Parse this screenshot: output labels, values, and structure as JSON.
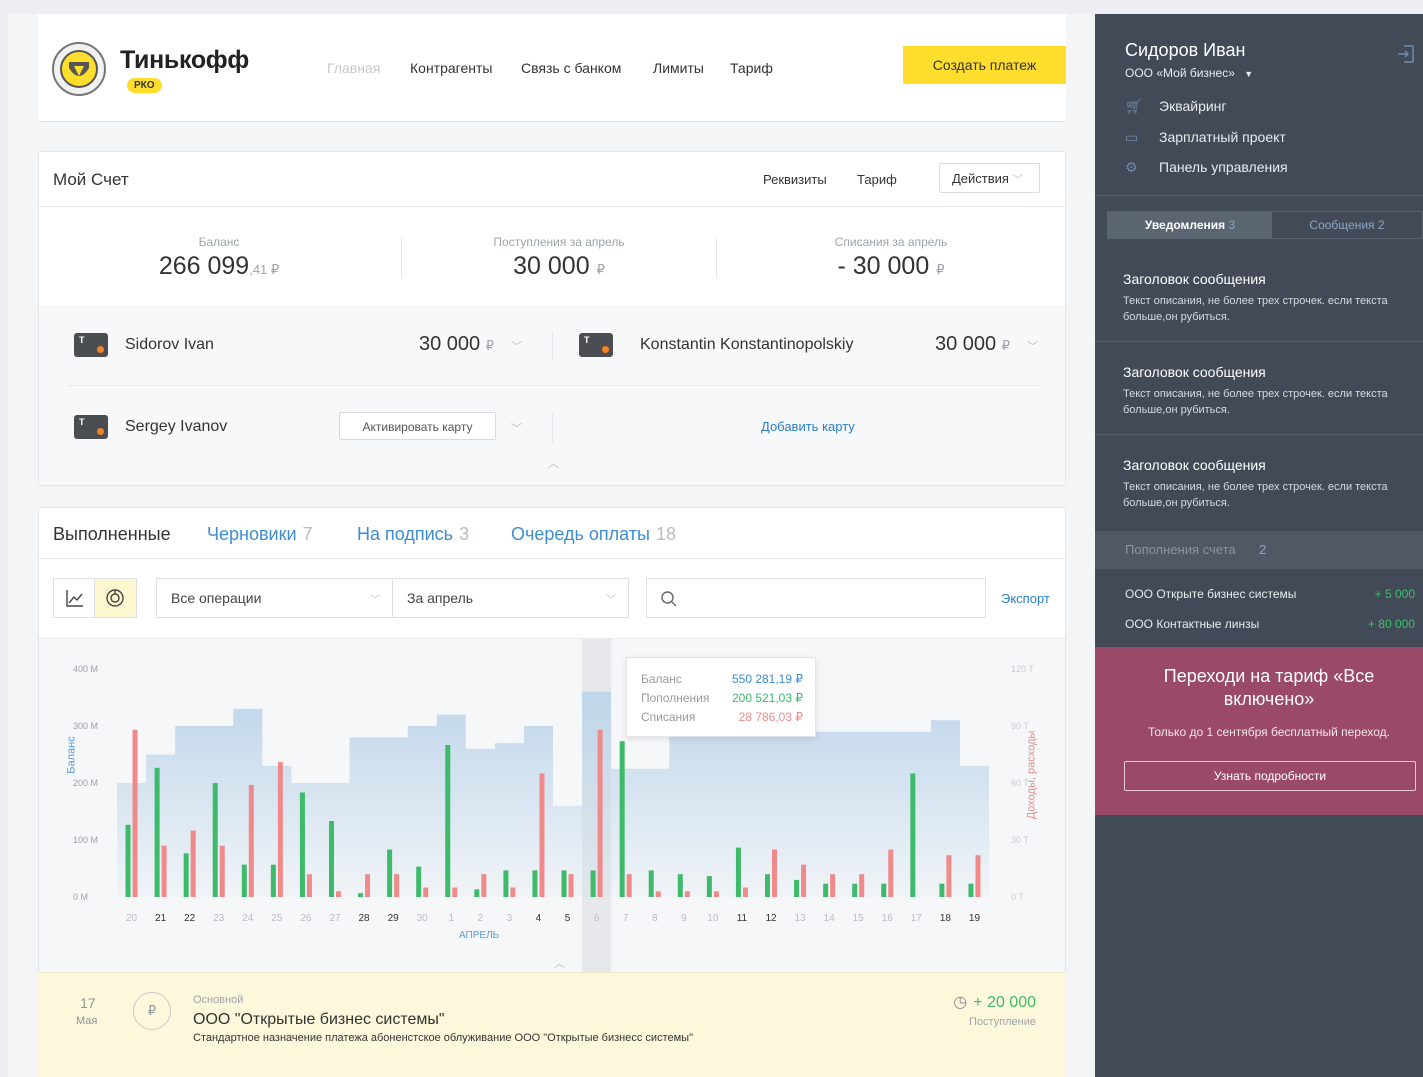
{
  "header": {
    "brand": "Тинькофф",
    "badge": "РКО",
    "nav": [
      "Главная",
      "Контрагенты",
      "Связь с банком",
      "Лимиты",
      "Тариф"
    ],
    "create_payment": "Создать платеж"
  },
  "account": {
    "title": "Мой Счет",
    "links": [
      "Реквизиты",
      "Тариф"
    ],
    "actions_label": "Действия",
    "balance_label": "Баланс",
    "balance_main": "266 099",
    "balance_cents": ",41 ₽",
    "income_label": "Поступления за апрель",
    "income_value": "30 000",
    "outgo_label": "Списания за апрель",
    "outgo_value": "- 30 000",
    "currency": "₽"
  },
  "cards": [
    {
      "holder": "Sidorov Ivan",
      "amount": "30 000"
    },
    {
      "holder": "Konstantin Konstantinopolskiy",
      "amount": "30 000"
    },
    {
      "holder": "Sergey Ivanov",
      "action": "Активировать карту"
    }
  ],
  "add_card": "Добавить карту",
  "ops": {
    "tabs": [
      {
        "label": "Выполненные",
        "count": ""
      },
      {
        "label": "Черновики",
        "count": "7"
      },
      {
        "label": "На подпись",
        "count": "3"
      },
      {
        "label": "Очередь оплаты",
        "count": "18"
      }
    ],
    "filter_ops": "Все операции",
    "filter_period": "За апрель",
    "search_placeholder": "",
    "export": "Экспорт"
  },
  "tooltip": {
    "rows": [
      {
        "label": "Баланс",
        "value": "550 281,19 ₽"
      },
      {
        "label": "Пополнения",
        "value": "200 521,03 ₽"
      },
      {
        "label": "Списания",
        "value": "28 786,03 ₽"
      }
    ]
  },
  "chart_data": {
    "type": "bar",
    "ylabel": "Баланс",
    "y2label": "Доходы, расходы",
    "xlabel": "АПРЕЛЬ",
    "y_ticks": [
      "400 M",
      "300 M",
      "200 M",
      "100 M",
      "0 M"
    ],
    "y2_ticks": [
      "120 T",
      "90 T",
      "60 T",
      "30 T",
      "0 T"
    ],
    "categories": [
      "20",
      "21",
      "22",
      "23",
      "24",
      "25",
      "26",
      "27",
      "28",
      "29",
      "30",
      "1",
      "2",
      "3",
      "4",
      "5",
      "6",
      "7",
      "8",
      "9",
      "10",
      "11",
      "12",
      "13",
      "14",
      "15",
      "16",
      "17",
      "18",
      "19"
    ],
    "highlight_categories": [
      "21",
      "22",
      "28",
      "29",
      "4",
      "5",
      "11",
      "12",
      "18",
      "19"
    ],
    "selected_category": "6",
    "series": [
      {
        "name": "Баланс",
        "axis": "left",
        "values": [
          200,
          250,
          300,
          300,
          330,
          230,
          200,
          200,
          280,
          280,
          300,
          320,
          260,
          270,
          300,
          160,
          360,
          225,
          225,
          320,
          300,
          300,
          290,
          290,
          290,
          290,
          290,
          290,
          310,
          230
        ]
      },
      {
        "name": "Доходы",
        "axis": "right",
        "values": [
          38,
          68,
          23,
          60,
          17,
          17,
          55,
          40,
          2,
          25,
          16,
          80,
          4,
          14,
          14,
          14,
          14,
          82,
          14,
          12,
          11,
          26,
          12,
          9,
          7,
          7,
          7,
          65,
          7,
          7
        ]
      },
      {
        "name": "Расходы",
        "axis": "right",
        "values": [
          88,
          27,
          35,
          27,
          59,
          71,
          12,
          3,
          12,
          12,
          5,
          5,
          12,
          5,
          65,
          12,
          88,
          12,
          3,
          3,
          3,
          5,
          25,
          17,
          12,
          12,
          25,
          0,
          22,
          22
        ]
      }
    ],
    "ylim": [
      0,
      400
    ],
    "y2lim": [
      0,
      120
    ]
  },
  "transaction": {
    "day": "17",
    "month": "Мая",
    "category": "Основной",
    "title": "ООО \"Открытые бизнес системы\"",
    "description": "Стандартное назначение платежа абоненстское облуживание ООО \"Открытые бизнесс системы\"",
    "amount": "+ 20 000",
    "type": "Поступление"
  },
  "sidebar": {
    "user": "Сидоров Иван",
    "org": "ООО «Мой бизнес»",
    "menu": [
      {
        "label": "Эквайринг",
        "icon": "cart-icon"
      },
      {
        "label": "Зарплатный проект",
        "icon": "wallet-icon"
      },
      {
        "label": "Панель управления",
        "icon": "gear-icon"
      }
    ],
    "tabs": [
      {
        "label": "Уведомления",
        "count": "3"
      },
      {
        "label": "Сообщения",
        "count": "2"
      }
    ],
    "notes": [
      {
        "title": "Заголовок сообщения",
        "body": "Текст описания, не более трех строчек. если текста больше,он рубиться."
      },
      {
        "title": "Заголовок сообщения",
        "body": "Текст описания, не более трех строчек. если текста больше,он рубиться."
      },
      {
        "title": "Заголовок сообщения",
        "body": "Текст описания, не более трех строчек. если текста больше,он рубиться."
      }
    ],
    "topups_title": "Пополнения счета",
    "topups_count": "2",
    "topups": [
      {
        "name": "ООО Открыте бизнес системы",
        "amount": "+ 5 000"
      },
      {
        "name": "ООО Контактные линзы",
        "amount": "+ 80 000"
      }
    ],
    "promo_title": "Переходи на тариф «Все включено»",
    "promo_text": "Только до 1 сентября бесплатный переход.",
    "promo_button": "Узнать подробности"
  },
  "colors": {
    "accent": "#ffdd2d",
    "sidebar": "#414a56",
    "income": "#3dba6a",
    "outgo": "#f08a8a",
    "balance": "#bfd6ea",
    "link": "#2a7ec9",
    "promo": "#9a4a68"
  }
}
